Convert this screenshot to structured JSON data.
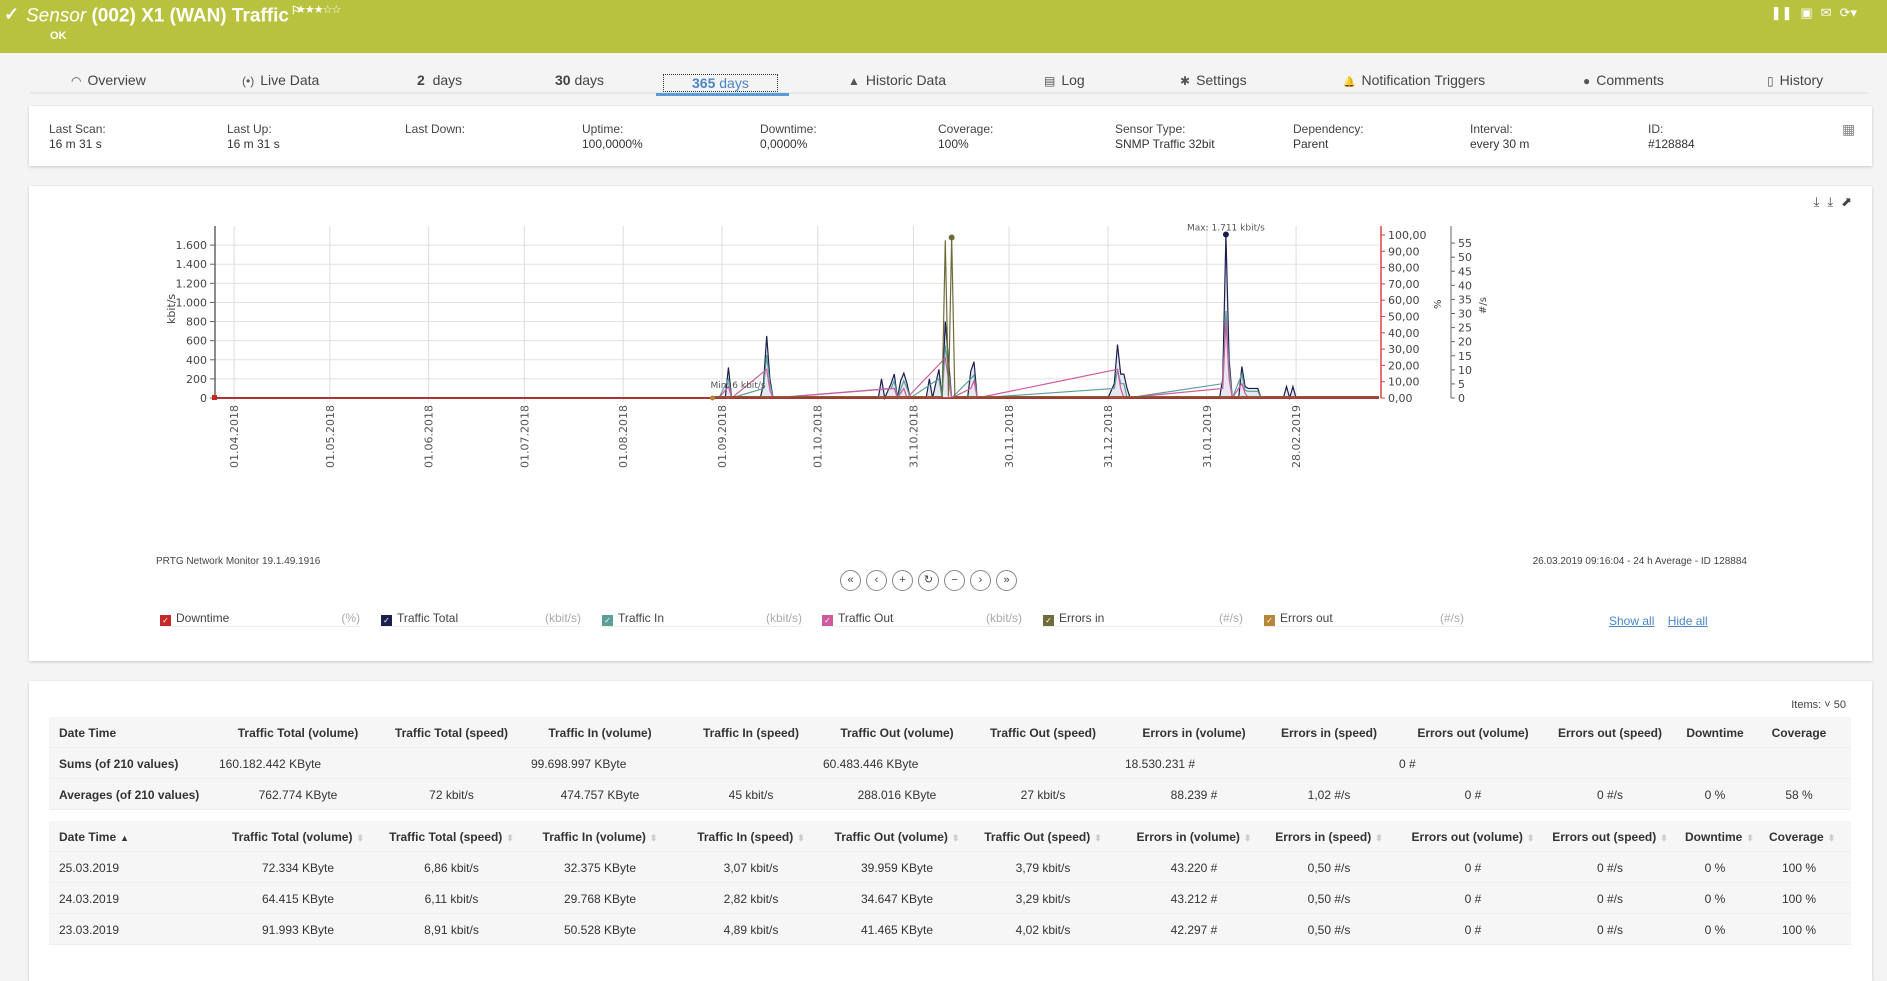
{
  "header": {
    "kind": "Sensor",
    "title": "(002) X1 (WAN) Traffic",
    "status": "OK",
    "stars": "★★★☆☆",
    "actions": [
      "pause-icon",
      "report-icon",
      "email-icon",
      "refresh-icon"
    ]
  },
  "tabs": [
    {
      "label": "Overview",
      "icon": "◠"
    },
    {
      "label": "Live Data",
      "icon": "(•)"
    },
    {
      "num": "2",
      "label": "days"
    },
    {
      "num": "30",
      "label": "days"
    },
    {
      "num": "365",
      "label": "days"
    },
    {
      "label": "Historic Data",
      "icon": "▲"
    },
    {
      "label": "Log",
      "icon": "▤"
    },
    {
      "label": "Settings",
      "icon": "✱"
    },
    {
      "label": "Notification Triggers",
      "icon": "🔔"
    },
    {
      "label": "Comments",
      "icon": "●"
    },
    {
      "label": "History",
      "icon": "▯"
    }
  ],
  "info": [
    {
      "label": "Last Scan:",
      "value": "16 m 31 s"
    },
    {
      "label": "Last Up:",
      "value": "16 m 31 s"
    },
    {
      "label": "Last Down:",
      "value": ""
    },
    {
      "label": "Uptime:",
      "value": "100,0000%"
    },
    {
      "label": "Downtime:",
      "value": "0,0000%"
    },
    {
      "label": "Coverage:",
      "value": "100%"
    },
    {
      "label": "Sensor Type:",
      "value": "SNMP Traffic 32bit"
    },
    {
      "label": "Dependency:",
      "value": "Parent"
    },
    {
      "label": "Interval:",
      "value": "every 30 m"
    },
    {
      "label": "ID:",
      "value": "#128884"
    }
  ],
  "chart": {
    "footer_left": "PRTG Network Monitor 19.1.49.1916",
    "footer_right": "26.03.2019 09:16:04 - 24 h Average - ID 128884",
    "nav": [
      "«",
      "‹",
      "+",
      "↻",
      "−",
      "›",
      "»"
    ],
    "legend": [
      {
        "label": "Downtime",
        "unit": "(%)",
        "color": "#c62828"
      },
      {
        "label": "Traffic Total",
        "unit": "(kbit/s)",
        "color": "#1a1f4e"
      },
      {
        "label": "Traffic In",
        "unit": "(kbit/s)",
        "color": "#5b9e9a"
      },
      {
        "label": "Traffic Out",
        "unit": "(kbit/s)",
        "color": "#d05a9e"
      },
      {
        "label": "Errors in",
        "unit": "(#/s)",
        "color": "#6f6c3a"
      },
      {
        "label": "Errors out",
        "unit": "(#/s)",
        "color": "#b8863b"
      }
    ],
    "show_all": "Show all",
    "hide_all": "Hide all"
  },
  "chart_data": {
    "type": "line",
    "title": "",
    "xlabel": "",
    "ylabel": "kbit/s",
    "ylabel_right1": "%",
    "ylabel_right2": "#/s",
    "ylim": [
      0,
      1800
    ],
    "ylim_right1": [
      0,
      100
    ],
    "ylim_right2": [
      0,
      60
    ],
    "yticks": [
      "0",
      "200",
      "400",
      "600",
      "800",
      "1.000",
      "1.200",
      "1.400",
      "1.600"
    ],
    "yticks_right1": [
      "0,00",
      "10,00",
      "20,00",
      "30,00",
      "40,00",
      "50,00",
      "60,00",
      "70,00",
      "80,00",
      "90,00",
      "100,00"
    ],
    "yticks_right2": [
      "0",
      "5",
      "10",
      "15",
      "20",
      "25",
      "30",
      "35",
      "40",
      "45",
      "50",
      "55"
    ],
    "xticks": [
      "01.04.2018",
      "01.05.2018",
      "01.06.2018",
      "01.07.2018",
      "01.08.2018",
      "01.09.2018",
      "01.10.2018",
      "31.10.2018",
      "30.11.2018",
      "31.12.2018",
      "31.01.2019",
      "28.02.2019"
    ],
    "x_range": [
      "26.03.2018",
      "26.03.2019"
    ],
    "annotations": [
      {
        "text": "Max: 1.711 kbit/s",
        "x": "20.02.2019",
        "y": 1711
      },
      {
        "text": "Min: 6 kbit/s",
        "x": "06.09.2018",
        "y": 6
      }
    ],
    "series": [
      {
        "name": "Traffic Total",
        "points": [
          [
            158,
            0
          ],
          [
            160,
            0
          ],
          [
            161,
            320
          ],
          [
            162,
            0
          ],
          [
            171,
            0
          ],
          [
            172,
            150
          ],
          [
            173,
            650
          ],
          [
            174,
            200
          ],
          [
            175,
            0
          ],
          [
            208,
            0
          ],
          [
            209,
            200
          ],
          [
            210,
            0
          ],
          [
            212,
            150
          ],
          [
            213,
            250
          ],
          [
            214,
            0
          ],
          [
            215,
            180
          ],
          [
            216,
            260
          ],
          [
            217,
            150
          ],
          [
            218,
            0
          ],
          [
            223,
            0
          ],
          [
            224,
            200
          ],
          [
            225,
            0
          ],
          [
            227,
            300
          ],
          [
            228,
            0
          ],
          [
            229,
            800
          ],
          [
            230,
            400
          ],
          [
            231,
            0
          ],
          [
            236,
            0
          ],
          [
            237,
            280
          ],
          [
            238,
            380
          ],
          [
            239,
            0
          ],
          [
            280,
            0
          ],
          [
            282,
            150
          ],
          [
            283,
            560
          ],
          [
            284,
            250
          ],
          [
            285,
            250
          ],
          [
            286,
            100
          ],
          [
            287,
            0
          ],
          [
            315,
            0
          ],
          [
            316,
            200
          ],
          [
            317,
            1711
          ],
          [
            318,
            400
          ],
          [
            319,
            0
          ],
          [
            321,
            0
          ],
          [
            322,
            330
          ],
          [
            323,
            120
          ],
          [
            324,
            100
          ],
          [
            327,
            100
          ],
          [
            328,
            0
          ],
          [
            335,
            0
          ],
          [
            336,
            120
          ],
          [
            337,
            0
          ],
          [
            338,
            120
          ],
          [
            339,
            0
          ],
          [
            365,
            0
          ]
        ]
      },
      {
        "name": "Traffic In",
        "points": [
          [
            158,
            0
          ],
          [
            161,
            200
          ],
          [
            162,
            0
          ],
          [
            172,
            100
          ],
          [
            173,
            450
          ],
          [
            174,
            150
          ],
          [
            175,
            0
          ],
          [
            212,
            100
          ],
          [
            213,
            180
          ],
          [
            214,
            0
          ],
          [
            216,
            180
          ],
          [
            217,
            100
          ],
          [
            218,
            0
          ],
          [
            227,
            200
          ],
          [
            228,
            0
          ],
          [
            229,
            550
          ],
          [
            230,
            300
          ],
          [
            231,
            0
          ],
          [
            237,
            200
          ],
          [
            238,
            240
          ],
          [
            239,
            0
          ],
          [
            282,
            100
          ],
          [
            283,
            300
          ],
          [
            284,
            150
          ],
          [
            285,
            150
          ],
          [
            286,
            0
          ],
          [
            316,
            150
          ],
          [
            317,
            910
          ],
          [
            318,
            300
          ],
          [
            319,
            0
          ],
          [
            322,
            250
          ],
          [
            323,
            80
          ],
          [
            324,
            70
          ],
          [
            327,
            70
          ],
          [
            328,
            0
          ],
          [
            365,
            0
          ]
        ]
      },
      {
        "name": "Traffic Out",
        "points": [
          [
            158,
            0
          ],
          [
            161,
            120
          ],
          [
            162,
            0
          ],
          [
            173,
            300
          ],
          [
            174,
            80
          ],
          [
            175,
            0
          ],
          [
            213,
            100
          ],
          [
            214,
            0
          ],
          [
            216,
            100
          ],
          [
            217,
            0
          ],
          [
            229,
            420
          ],
          [
            230,
            200
          ],
          [
            231,
            0
          ],
          [
            237,
            100
          ],
          [
            238,
            180
          ],
          [
            239,
            0
          ],
          [
            283,
            300
          ],
          [
            284,
            100
          ],
          [
            285,
            0
          ],
          [
            316,
            100
          ],
          [
            317,
            800
          ],
          [
            318,
            200
          ],
          [
            319,
            0
          ],
          [
            322,
            150
          ],
          [
            323,
            50
          ],
          [
            324,
            0
          ],
          [
            365,
            0
          ]
        ]
      },
      {
        "name": "Errors in",
        "points": [
          [
            156,
            0.5
          ],
          [
            228,
            0.5
          ],
          [
            229,
            56
          ],
          [
            230,
            0.5
          ],
          [
            231,
            57
          ],
          [
            232,
            0.5
          ],
          [
            365,
            0.5
          ]
        ]
      },
      {
        "name": "Errors out",
        "points": [
          [
            156,
            0
          ],
          [
            365,
            0
          ]
        ]
      },
      {
        "name": "Downtime",
        "points": [
          [
            0,
            0
          ],
          [
            365,
            0
          ]
        ]
      }
    ]
  },
  "table": {
    "items_label": "Items:",
    "items_value": "50",
    "summary_headers": [
      "Date Time",
      "Traffic Total (volume)",
      "Traffic Total (speed)",
      "Traffic In (volume)",
      "Traffic In (speed)",
      "Traffic Out (volume)",
      "Traffic Out (speed)",
      "Errors in (volume)",
      "Errors in (speed)",
      "Errors out (volume)",
      "Errors out (speed)",
      "Downtime",
      "Coverage"
    ],
    "sums": [
      "Sums (of 210 values)",
      "160.182.442 KByte",
      "",
      "99.698.997 KByte",
      "",
      "60.483.446 KByte",
      "",
      "18.530.231 #",
      "",
      "0 #",
      "",
      "",
      ""
    ],
    "averages": [
      "Averages (of 210 values)",
      "762.774 KByte",
      "72 kbit/s",
      "474.757 KByte",
      "45 kbit/s",
      "288.016 KByte",
      "27 kbit/s",
      "88.239 #",
      "1,02 #/s",
      "0 #",
      "0 #/s",
      "0 %",
      "58 %"
    ],
    "headers": [
      "Date Time",
      "Traffic Total (volume)",
      "Traffic Total (speed)",
      "Traffic In (volume)",
      "Traffic In (speed)",
      "Traffic Out (volume)",
      "Traffic Out (speed)",
      "Errors in (volume)",
      "Errors in (speed)",
      "Errors out (volume)",
      "Errors out (speed)",
      "Downtime",
      "Coverage"
    ],
    "rows": [
      [
        "25.03.2019",
        "72.334 KByte",
        "6,86 kbit/s",
        "32.375 KByte",
        "3,07 kbit/s",
        "39.959 KByte",
        "3,79 kbit/s",
        "43.220 #",
        "0,50 #/s",
        "0 #",
        "0 #/s",
        "0 %",
        "100 %"
      ],
      [
        "24.03.2019",
        "64.415 KByte",
        "6,11 kbit/s",
        "29.768 KByte",
        "2,82 kbit/s",
        "34.647 KByte",
        "3,29 kbit/s",
        "43.212 #",
        "0,50 #/s",
        "0 #",
        "0 #/s",
        "0 %",
        "100 %"
      ],
      [
        "23.03.2019",
        "91.993 KByte",
        "8,91 kbit/s",
        "50.528 KByte",
        "4,89 kbit/s",
        "41.465 KByte",
        "4,02 kbit/s",
        "42.297 #",
        "0,50 #/s",
        "0 #",
        "0 #/s",
        "0 %",
        "100 %"
      ]
    ]
  }
}
